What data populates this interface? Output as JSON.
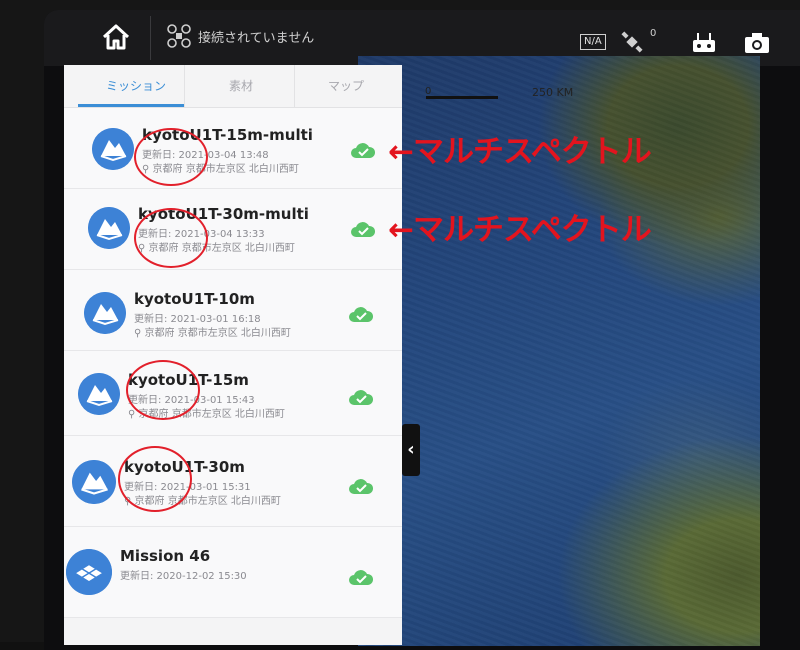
{
  "topbar": {
    "connection_status": "接続されていません",
    "gps_label": "N/A",
    "satellite_count": "0",
    "icons": [
      "home-icon",
      "drone-icon",
      "satellite-icon",
      "remote-controller-icon",
      "camera-icon"
    ]
  },
  "map": {
    "scale_zero": "0",
    "scale_label": "250 KM"
  },
  "tabs": [
    {
      "label": "ミッション",
      "active": true
    },
    {
      "label": "素材",
      "active": false
    },
    {
      "label": "マップ",
      "active": false
    }
  ],
  "missions": [
    {
      "title": "kyotoU1T-15m-multi",
      "date": "更新日: 2021-03-04 13:48",
      "location": "京都府 京都市左京区 北白川西町",
      "synced": true
    },
    {
      "title": "kyotoU1T-30m-multi",
      "date": "更新日: 2021-03-04 13:33",
      "location": "京都府 京都市左京区 北白川西町",
      "synced": true
    },
    {
      "title": "kyotoU1T-10m",
      "date": "更新日: 2021-03-01 16:18",
      "location": "京都府 京都市左京区 北白川西町",
      "synced": true
    },
    {
      "title": "kyotoU1T-15m",
      "date": "更新日: 2021-03-01 15:43",
      "location": "京都府 京都市左京区 北白川西町",
      "synced": true
    },
    {
      "title": "kyotoU1T-30m",
      "date": "更新日: 2021-03-01 15:31",
      "location": "京都府 京都市左京区 北白川西町",
      "synced": true
    },
    {
      "title": "Mission 46",
      "date": "更新日: 2020-12-02 15:30",
      "location": "",
      "synced": true
    }
  ],
  "annotations": [
    {
      "text": "←マルチスペクトル"
    },
    {
      "text": "←マルチスペクトル"
    }
  ],
  "colors": {
    "accent": "#3b8ed6",
    "check": "#5bc46a",
    "annotation": "#e3141e"
  }
}
